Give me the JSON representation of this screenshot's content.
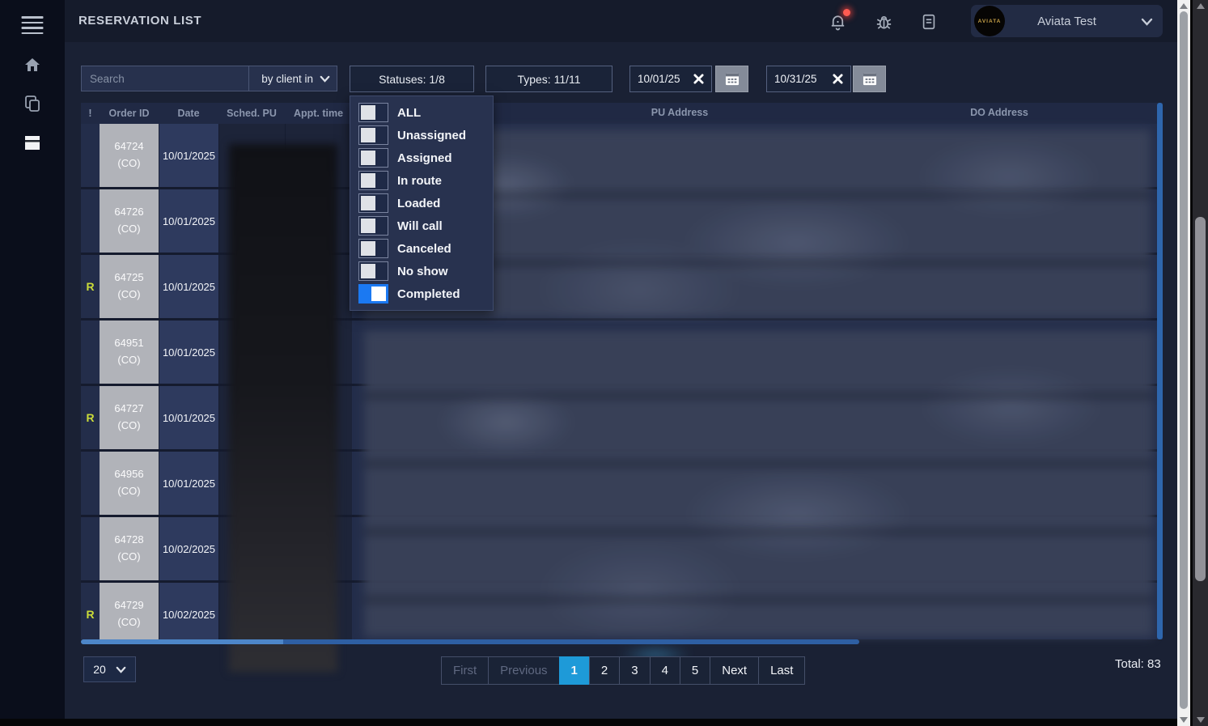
{
  "app": {
    "title": "RESERVATION LIST",
    "account_name": "Aviata Test",
    "logo_text": "AVIATA"
  },
  "filters": {
    "search_placeholder": "Search",
    "search_by_value": "by client in",
    "statuses_label": "Statuses: 1/8",
    "types_label": "Types: 11/11",
    "date_from": "10/01/25",
    "date_to": "10/31/25"
  },
  "status_dropdown": {
    "items": [
      {
        "label": "ALL",
        "state": "off"
      },
      {
        "label": "Unassigned",
        "state": "off"
      },
      {
        "label": "Assigned",
        "state": "off"
      },
      {
        "label": "In route",
        "state": "off"
      },
      {
        "label": "Loaded",
        "state": "off"
      },
      {
        "label": "Will call",
        "state": "off"
      },
      {
        "label": "Canceled",
        "state": "off"
      },
      {
        "label": "No show",
        "state": "off"
      },
      {
        "label": "Completed",
        "state": "on"
      }
    ]
  },
  "table": {
    "headers": [
      "!",
      "Order ID",
      "Date",
      "Sched. PU",
      "Appt. time",
      "PU Address",
      "DO Address"
    ],
    "rows": [
      {
        "alert": "",
        "order_id": "64724",
        "order_type": "(CO)",
        "date": "10/01/2025"
      },
      {
        "alert": "",
        "order_id": "64726",
        "order_type": "(CO)",
        "date": "10/01/2025"
      },
      {
        "alert": "R",
        "order_id": "64725",
        "order_type": "(CO)",
        "date": "10/01/2025"
      },
      {
        "alert": "",
        "order_id": "64951",
        "order_type": "(CO)",
        "date": "10/01/2025"
      },
      {
        "alert": "R",
        "order_id": "64727",
        "order_type": "(CO)",
        "date": "10/01/2025"
      },
      {
        "alert": "",
        "order_id": "64956",
        "order_type": "(CO)",
        "date": "10/01/2025"
      },
      {
        "alert": "",
        "order_id": "64728",
        "order_type": "(CO)",
        "date": "10/02/2025"
      },
      {
        "alert": "R",
        "order_id": "64729",
        "order_type": "(CO)",
        "date": "10/02/2025"
      }
    ]
  },
  "pagination": {
    "page_size": "20",
    "total": "Total: 83",
    "buttons": [
      {
        "label": "First",
        "state": "disabled"
      },
      {
        "label": "Previous",
        "state": "disabled"
      },
      {
        "label": "1",
        "state": "active"
      },
      {
        "label": "2",
        "state": ""
      },
      {
        "label": "3",
        "state": ""
      },
      {
        "label": "4",
        "state": ""
      },
      {
        "label": "5",
        "state": ""
      },
      {
        "label": "Next",
        "state": ""
      },
      {
        "label": "Last",
        "state": ""
      }
    ]
  },
  "colors": {
    "accent_blue": "#1b79f2",
    "pagination_active": "#1e9ad8",
    "alert_r": "#cbdc39",
    "completed_row_gray": "#b1b3b9",
    "notification_red": "#ff5b52"
  }
}
